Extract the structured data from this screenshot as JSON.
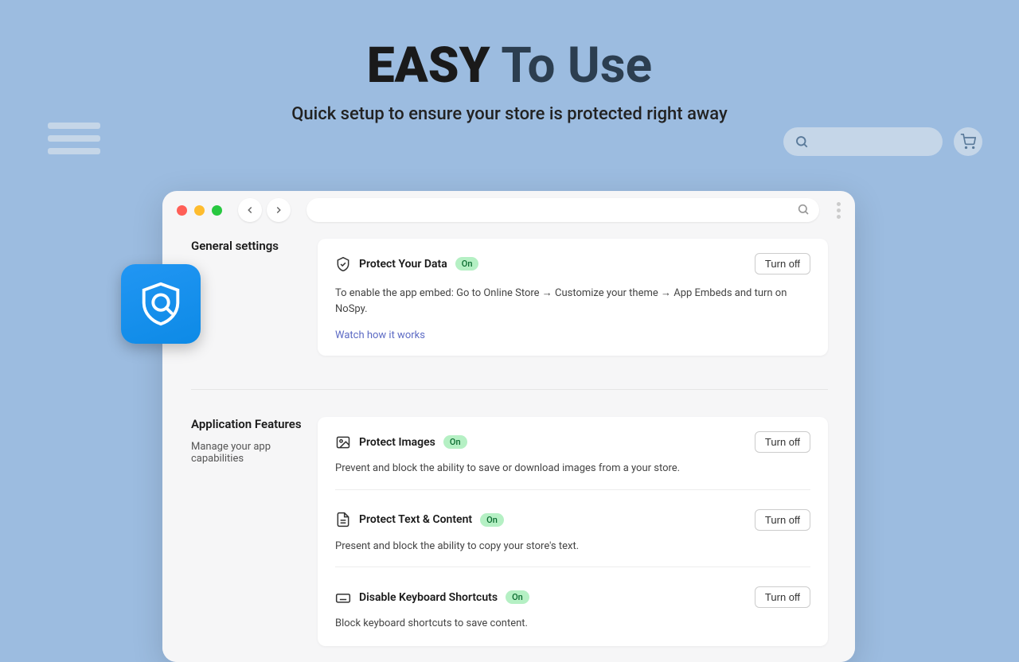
{
  "hero": {
    "title_bold": "EASY",
    "title_rest": "To Use",
    "subtitle": "Quick setup to ensure your store is protected right away"
  },
  "sidebar": {
    "general_title": "General settings",
    "features_title": "Application Features",
    "features_desc": "Manage your app capabilities"
  },
  "cards": {
    "protect_data": {
      "title": "Protect Your Data",
      "badge": "On",
      "btn": "Turn off",
      "desc": "To enable the app embed: Go to Online Store → Customize your theme → App Embeds and turn on NoSpy.",
      "link": "Watch how it works"
    },
    "protect_images": {
      "title": "Protect Images",
      "badge": "On",
      "btn": "Turn off",
      "desc": "Prevent and block the ability to save or download images from a your store."
    },
    "protect_text": {
      "title": "Protect Text & Content",
      "badge": "On",
      "btn": "Turn off",
      "desc": "Present and block the ability to copy your store's text."
    },
    "disable_keyboard": {
      "title": "Disable Keyboard Shortcuts",
      "badge": "On",
      "btn": "Turn off",
      "desc": "Block keyboard shortcuts to save content."
    }
  }
}
